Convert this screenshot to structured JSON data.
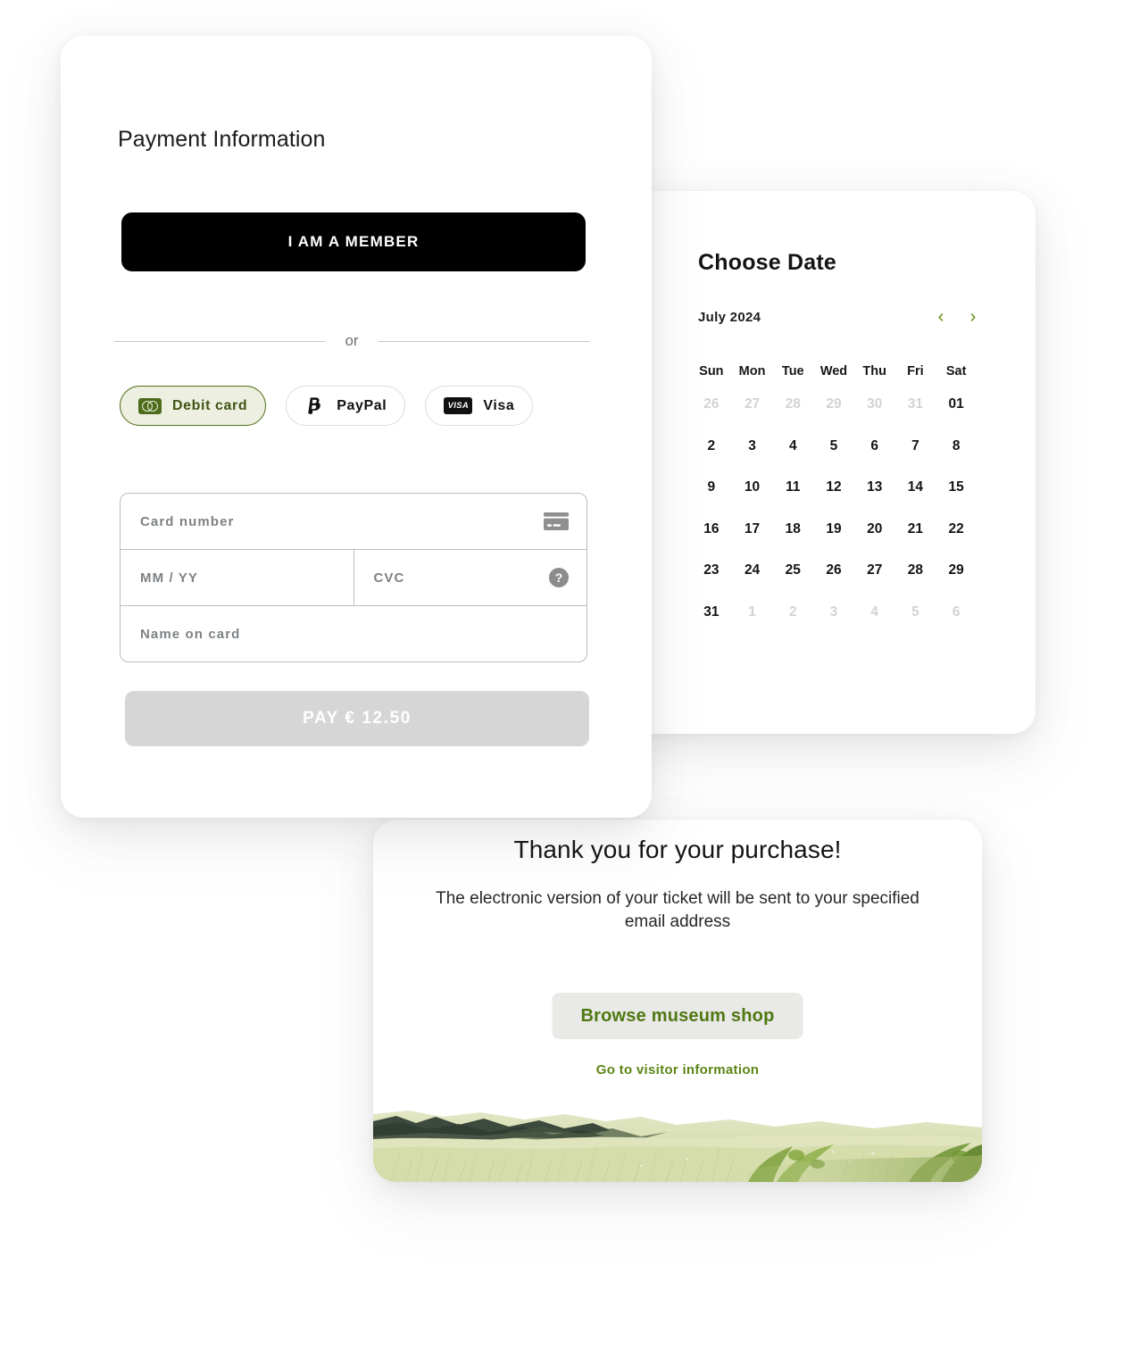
{
  "payment": {
    "title": "Payment Information",
    "member_button": "I AM A MEMBER",
    "divider_text": "or",
    "methods": [
      {
        "label": "Debit card",
        "icon": "mastercard-icon",
        "selected": true
      },
      {
        "label": "PayPal",
        "icon": "paypal-icon",
        "selected": false
      },
      {
        "label": "Visa",
        "icon": "visa-icon",
        "selected": false
      }
    ],
    "visa_badge_text": "VISA",
    "fields": {
      "card_number_placeholder": "Card number",
      "card_number_value": "",
      "expiry_placeholder": "MM / YY",
      "expiry_value": "",
      "cvc_placeholder": "CVC",
      "cvc_value": "",
      "name_placeholder": "Name on card",
      "name_value": "",
      "help_icon_glyph": "?"
    },
    "pay_button": "PAY € 12.50",
    "colors": {
      "accent_green": "#53701d",
      "selected_bg": "#edf0e0",
      "member_bg": "#000000",
      "pay_disabled_bg": "#d6d6d6"
    }
  },
  "calendar": {
    "title": "Choose Date",
    "month_label": "July 2024",
    "prev_arrow": "‹",
    "next_arrow": "›",
    "weekdays": [
      "Sun",
      "Mon",
      "Tue",
      "Wed",
      "Thu",
      "Fri",
      "Sat"
    ],
    "weeks": [
      [
        {
          "d": "26",
          "muted": true
        },
        {
          "d": "27",
          "muted": true
        },
        {
          "d": "28",
          "muted": true
        },
        {
          "d": "29",
          "muted": true
        },
        {
          "d": "30",
          "muted": true
        },
        {
          "d": "31",
          "muted": true
        },
        {
          "d": "01",
          "muted": false
        }
      ],
      [
        {
          "d": "2",
          "muted": false
        },
        {
          "d": "3",
          "muted": false
        },
        {
          "d": "4",
          "muted": false
        },
        {
          "d": "5",
          "muted": false
        },
        {
          "d": "6",
          "muted": false
        },
        {
          "d": "7",
          "muted": false
        },
        {
          "d": "8",
          "muted": false
        }
      ],
      [
        {
          "d": "9",
          "muted": false
        },
        {
          "d": "10",
          "muted": false
        },
        {
          "d": "11",
          "muted": false
        },
        {
          "d": "12",
          "muted": false
        },
        {
          "d": "13",
          "muted": false
        },
        {
          "d": "14",
          "muted": false
        },
        {
          "d": "15",
          "muted": false
        }
      ],
      [
        {
          "d": "16",
          "muted": false
        },
        {
          "d": "17",
          "muted": false
        },
        {
          "d": "18",
          "muted": false
        },
        {
          "d": "19",
          "muted": false
        },
        {
          "d": "20",
          "muted": false
        },
        {
          "d": "21",
          "muted": false
        },
        {
          "d": "22",
          "muted": false
        }
      ],
      [
        {
          "d": "23",
          "muted": false
        },
        {
          "d": "24",
          "muted": false
        },
        {
          "d": "25",
          "muted": false
        },
        {
          "d": "26",
          "muted": false
        },
        {
          "d": "27",
          "muted": false
        },
        {
          "d": "28",
          "muted": false
        },
        {
          "d": "29",
          "muted": false
        }
      ],
      [
        {
          "d": "31",
          "muted": false
        },
        {
          "d": "1",
          "muted": true
        },
        {
          "d": "2",
          "muted": true
        },
        {
          "d": "3",
          "muted": true
        },
        {
          "d": "4",
          "muted": true
        },
        {
          "d": "5",
          "muted": true
        },
        {
          "d": "6",
          "muted": true
        }
      ]
    ],
    "arrow_color": "#5e8c12"
  },
  "thanks": {
    "title": "Thank you for your purchase!",
    "subtitle": "The electronic version of your ticket will be sent to your specified email address",
    "shop_button": "Browse museum shop",
    "info_link": "Go to visitor information",
    "image_alt": "impressionist-meadow-painting",
    "colors": {
      "link_green": "#5c8516",
      "button_bg": "#e9e9e7",
      "button_text": "#4f7812"
    }
  }
}
